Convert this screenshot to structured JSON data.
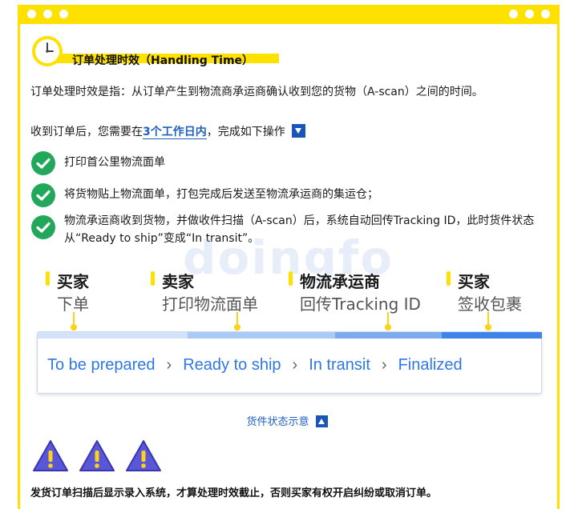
{
  "section": {
    "title": "订单处理时效（Handling Time）"
  },
  "intro": {
    "definition": "订单处理时效是指：从订单产生到物流商承运商确认收到您的货物（A-scan）之间的时间。",
    "before_highlight": "收到订单后，您需要在",
    "highlight": "3个工作日内",
    "after_highlight": "，完成如下操作"
  },
  "steps": [
    {
      "text": "打印首公里物流面单"
    },
    {
      "text": "将货物贴上物流面单，打包完成后发送至物流承运商的集运仓；"
    },
    {
      "text": "物流承运商收到货物，并做收件扫描（A-scan）后，系统自动回传Tracking ID，此时货件状态从“Ready to ship”变成“In transit”。"
    }
  ],
  "watermark": "doingfo",
  "stages": [
    {
      "actor": "买家",
      "action": "下单"
    },
    {
      "actor": "卖家",
      "action": "打印物流面单"
    },
    {
      "actor": "物流承运商",
      "action": "回传Tracking ID"
    },
    {
      "actor": "买家",
      "action": "签收包裹"
    }
  ],
  "statuses": [
    "To be prepared",
    "Ready to ship",
    "In transit",
    "Finalized"
  ],
  "caption": "货件状态示意",
  "notice": "发货订单扫描后显示录入系统，才算处理时效截止，否则买家有权开启纠纷或取消订单。",
  "colors": {
    "brand_yellow": "#ffe100",
    "accent_blue": "#1f5fbf",
    "status_blue": "#2e78e6",
    "check_green": "#22a85a"
  }
}
